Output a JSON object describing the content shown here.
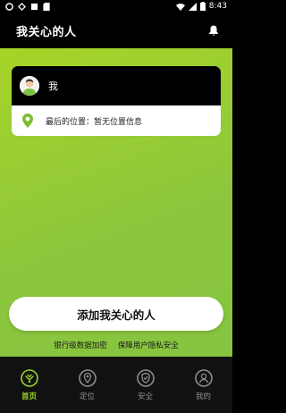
{
  "status_bar": {
    "time": "8:43"
  },
  "header": {
    "title": "我关心的人"
  },
  "card": {
    "name": "我",
    "location_label": "最后的位置：",
    "location_value": "暂无位置信息"
  },
  "main": {
    "add_button_label": "添加我关心的人",
    "security_note_1": "银行级数据加密",
    "security_note_2": "保障用户隐私安全"
  },
  "tabs": [
    {
      "label": "首页",
      "icon": "home-icon",
      "active": true
    },
    {
      "label": "定位",
      "icon": "location-icon",
      "active": false
    },
    {
      "label": "安全",
      "icon": "shield-icon",
      "active": false
    },
    {
      "label": "我的",
      "icon": "profile-icon",
      "active": false
    }
  ],
  "colors": {
    "accent": "#9bd22e",
    "gradient_start": "#a6d427",
    "gradient_end": "#86c43f"
  }
}
